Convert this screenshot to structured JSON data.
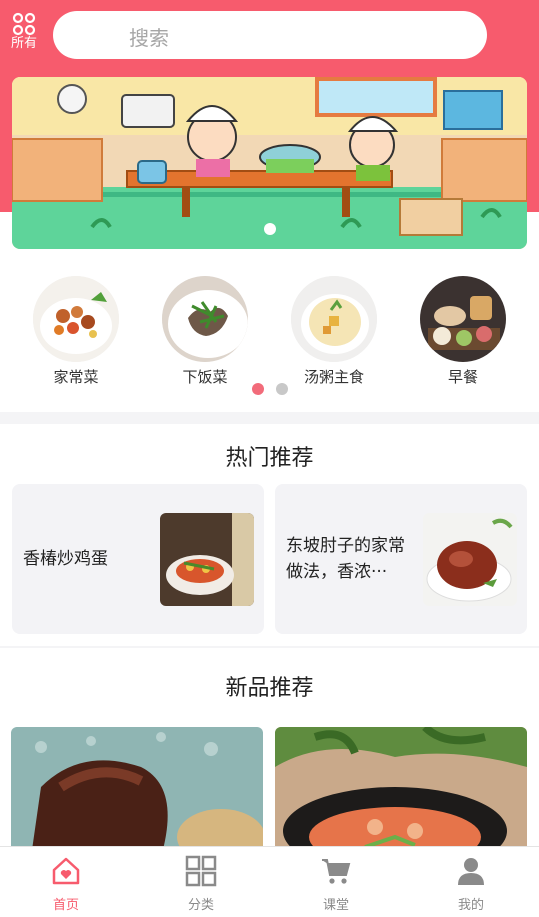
{
  "header": {
    "all_label": "所有",
    "search_placeholder": "搜索"
  },
  "banner": {
    "page_count": 2,
    "active_page": 1
  },
  "categories": [
    {
      "label": "家常菜"
    },
    {
      "label": "下饭菜"
    },
    {
      "label": "汤粥主食"
    },
    {
      "label": "早餐"
    }
  ],
  "hot": {
    "title": "热门推荐",
    "items": [
      {
        "title": "香椿炒鸡蛋"
      },
      {
        "title_line1": "东坡肘子的家常",
        "title_line2": "做法，香浓···"
      }
    ]
  },
  "new": {
    "title": "新品推荐"
  },
  "tabbar": [
    {
      "label": "首页",
      "icon": "home-icon",
      "active": true
    },
    {
      "label": "分类",
      "icon": "grid-icon"
    },
    {
      "label": "课堂",
      "icon": "cart-icon"
    },
    {
      "label": "我的",
      "icon": "user-icon"
    }
  ],
  "colors": {
    "accent": "#f75b6d",
    "inactive": "#8a8a8a",
    "page_dot_active": "#f26b7a",
    "page_dot_inactive": "#c8c8c8"
  }
}
